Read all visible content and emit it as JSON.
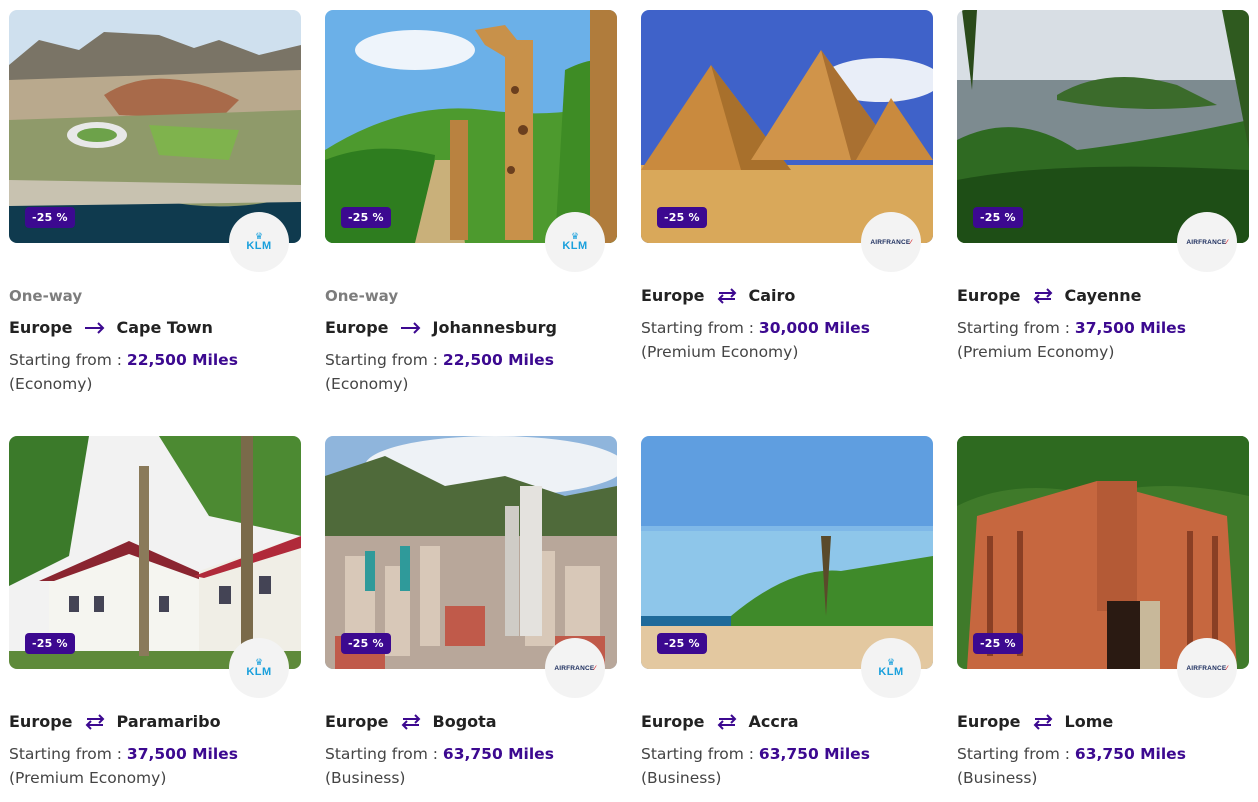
{
  "cards": [
    {
      "trip_type": "One-way",
      "origin": "Europe",
      "destination": "Cape Town",
      "arrow": "one-way-arrow-icon",
      "price_prefix": "Starting from : ",
      "miles": "22,500 Miles",
      "cabin": " (Economy)",
      "discount": "-25 %",
      "airline": "KLM"
    },
    {
      "trip_type": "One-way",
      "origin": "Europe",
      "destination": "Johannesburg",
      "arrow": "one-way-arrow-icon",
      "price_prefix": "Starting from : ",
      "miles": "22,500 Miles",
      "cabin": " (Economy)",
      "discount": "-25 %",
      "airline": "KLM"
    },
    {
      "trip_type": "",
      "origin": "Europe",
      "destination": "Cairo",
      "arrow": "round-trip-arrows-icon",
      "price_prefix": "Starting from : ",
      "miles": "30,000 Miles",
      "cabin": " (Premium Economy)",
      "discount": "-25 %",
      "airline": "AIRFRANCE"
    },
    {
      "trip_type": "",
      "origin": "Europe",
      "destination": "Cayenne",
      "arrow": "round-trip-arrows-icon",
      "price_prefix": "Starting from : ",
      "miles": "37,500 Miles",
      "cabin": " (Premium Economy)",
      "discount": "-25 %",
      "airline": "AIRFRANCE"
    },
    {
      "trip_type": "",
      "origin": "Europe",
      "destination": "Paramaribo",
      "arrow": "round-trip-arrows-icon",
      "price_prefix": "Starting from : ",
      "miles": "37,500 Miles",
      "cabin": " (Premium Economy)",
      "discount": "-25 %",
      "airline": "KLM"
    },
    {
      "trip_type": "",
      "origin": "Europe",
      "destination": "Bogota",
      "arrow": "round-trip-arrows-icon",
      "price_prefix": "Starting from : ",
      "miles": "63,750 Miles",
      "cabin": " (Business)",
      "discount": "-25 %",
      "airline": "AIRFRANCE"
    },
    {
      "trip_type": "",
      "origin": "Europe",
      "destination": "Accra",
      "arrow": "round-trip-arrows-icon",
      "price_prefix": "Starting from : ",
      "miles": "63,750 Miles",
      "cabin": " (Business)",
      "discount": "-25 %",
      "airline": "KLM"
    },
    {
      "trip_type": "",
      "origin": "Europe",
      "destination": "Lome",
      "arrow": "round-trip-arrows-icon",
      "price_prefix": "Starting from : ",
      "miles": "63,750 Miles",
      "cabin": " (Business)",
      "discount": "-25 %",
      "airline": "AIRFRANCE"
    }
  ],
  "colors": {
    "accent": "#3c0990",
    "klm_blue": "#1aa0dc",
    "af_navy": "#1a2b5c",
    "af_red": "#d61f26"
  }
}
